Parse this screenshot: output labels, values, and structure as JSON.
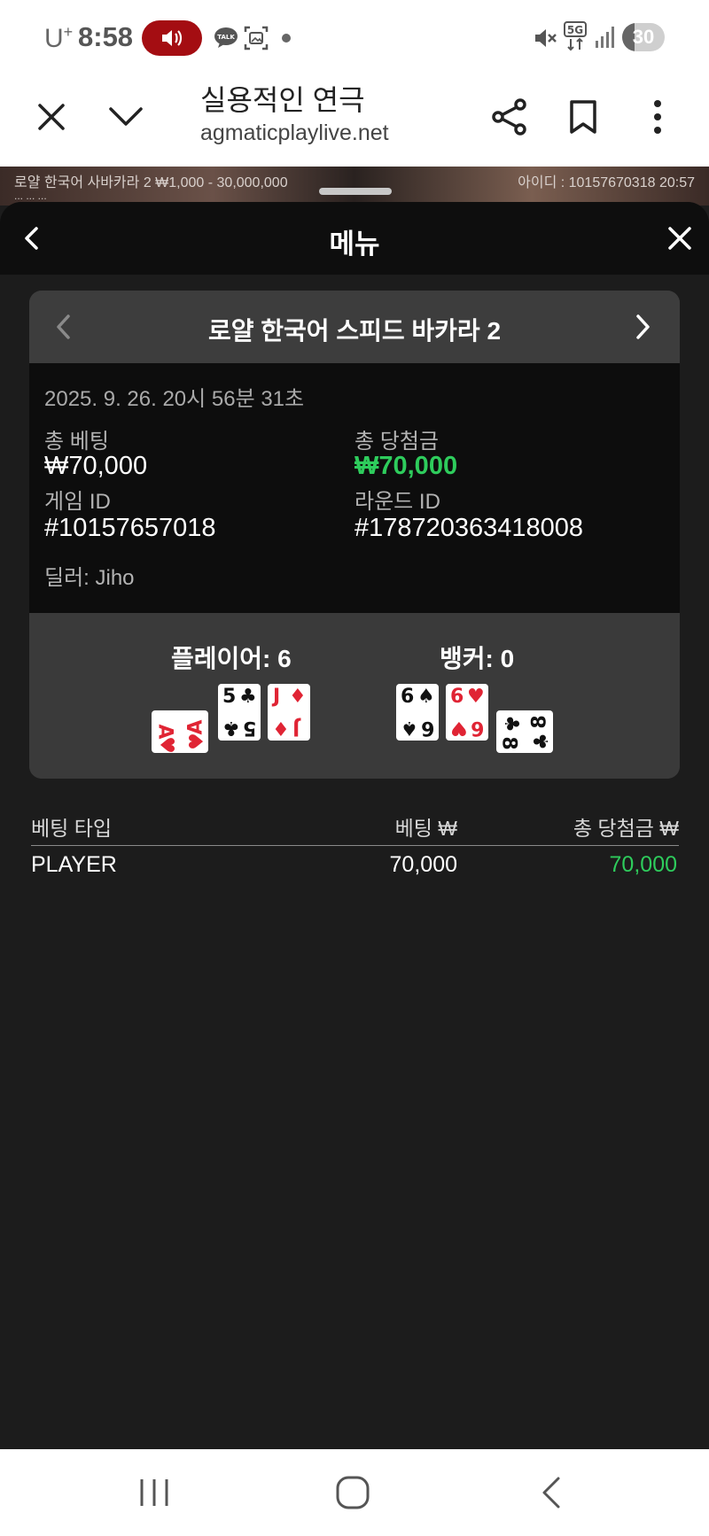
{
  "status_bar": {
    "carrier": "U",
    "carrier_sup": "+",
    "time": "8:58",
    "battery": "30",
    "icons": [
      "sound-on-icon",
      "talk-icon",
      "gallery-icon",
      "dot-icon",
      "mute-icon",
      "5g-icon",
      "signal-icon"
    ]
  },
  "browser": {
    "title": "실용적인 연극",
    "url": "agmaticplaylive.net",
    "icons": [
      "close-icon",
      "chevron-down-icon",
      "share-icon",
      "bookmark-icon",
      "more-icon"
    ]
  },
  "video_peek": {
    "left_text": "로얄 한국어 사바카라 2 ₩1,000 - 30,000,000",
    "right_text": "아이디 : 10157670318 20:57",
    "sub_text": "...   ...   ..."
  },
  "sheet": {
    "title": "메뉴"
  },
  "card": {
    "title": "로얄 한국어 스피드 바카라 2",
    "timestamp": "2025. 9. 26. 20시 56분 31초",
    "total_bet_label": "총 베팅",
    "total_bet_value": "₩70,000",
    "total_win_label": "총 당첨금",
    "total_win_value": "₩70,000",
    "game_id_label": "게임 ID",
    "game_id_value": "#10157657018",
    "round_id_label": "라운드 ID",
    "round_id_value": "#178720363418008",
    "dealer": "딜러: Jiho",
    "player_label": "플레이어: 6",
    "banker_label": "뱅커: 0",
    "player_cards": [
      {
        "rank": "A",
        "suit": "♥",
        "color": "red",
        "orientation": "sideways"
      },
      {
        "rank": "5",
        "suit": "♣",
        "color": "black",
        "orientation": "upright"
      },
      {
        "rank": "J",
        "suit": "♦",
        "color": "red",
        "orientation": "upright"
      }
    ],
    "banker_cards": [
      {
        "rank": "6",
        "suit": "♠",
        "color": "black",
        "orientation": "upright"
      },
      {
        "rank": "6",
        "suit": "♥",
        "color": "red",
        "orientation": "upright"
      },
      {
        "rank": "8",
        "suit": "♣",
        "color": "black",
        "orientation": "sideways"
      }
    ]
  },
  "bets": {
    "headers": [
      "베팅 타입",
      "베팅 ₩",
      "총 당첨금 ₩"
    ],
    "rows": [
      {
        "type": "PLAYER",
        "bet": "70,000",
        "win": "70,000"
      }
    ],
    "colors": {
      "win": "#2ecc5c"
    }
  },
  "navbar": {
    "icons": [
      "recent-apps-icon",
      "home-icon",
      "back-icon"
    ]
  }
}
